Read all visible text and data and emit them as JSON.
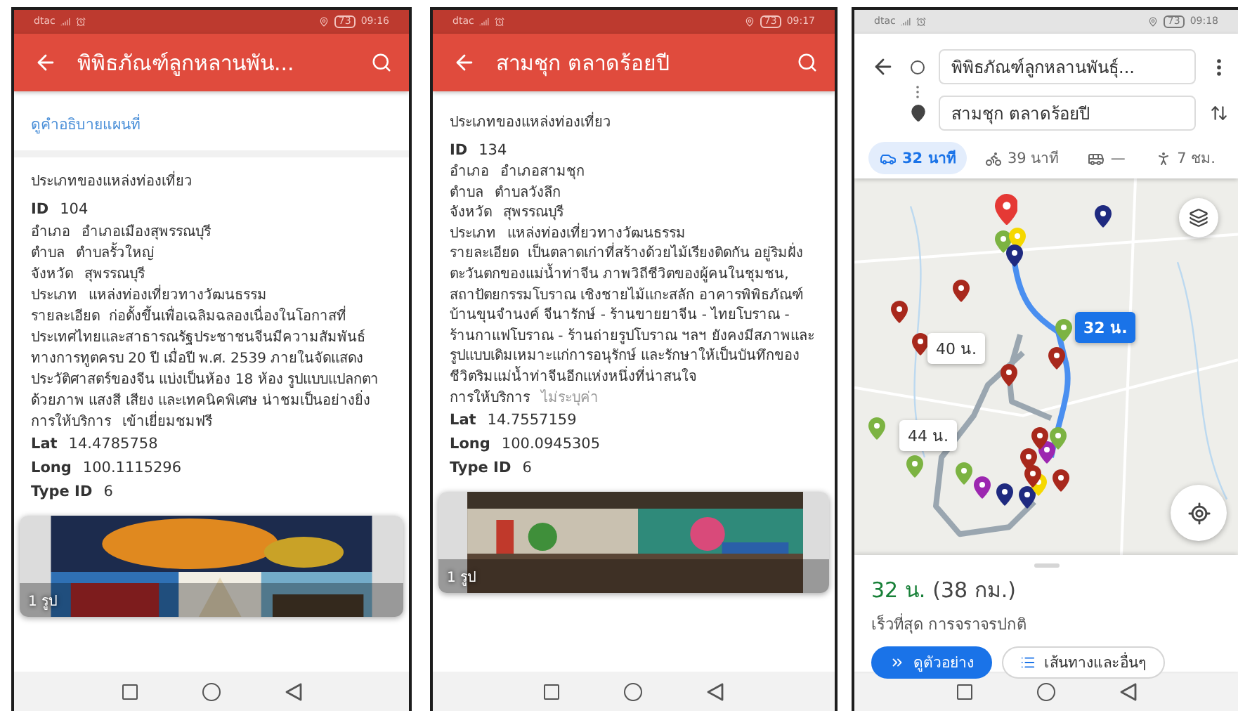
{
  "screens": [
    {
      "kind": "place_detail",
      "status_bar": {
        "carrier": "dtac",
        "battery": "73",
        "time": "09:16"
      },
      "title": "พิพิธภัณฑ์ลูกหลานพัน...",
      "map_link": "ดูคำอธิบายแผนที่",
      "section_title": "ประเภทของแหล่งท่องเที่ยว",
      "fields": [
        {
          "kind": "coded",
          "label": "ID",
          "value": "104"
        },
        {
          "kind": "text",
          "label": "อำเภอ",
          "value": "อำเภอเมืองสุพรรณบุรี"
        },
        {
          "kind": "text",
          "label": "ตำบล",
          "value": "ตำบลรั้วใหญ่"
        },
        {
          "kind": "text",
          "label": "จังหวัด",
          "value": "สุพรรณบุรี"
        },
        {
          "kind": "text",
          "label": "ประเภท",
          "value": "แหล่งท่องเที่ยวทางวัฒนธรรม"
        },
        {
          "kind": "paragraph",
          "text": "รายละเอียด  ก่อตั้งขึ้นเพื่อเฉลิมฉลองเนื่องในโอกาสที่ประเทศไทยและสาธารณรัฐประชาชนจีนมีความสัมพันธ์ทางการทูตครบ 20 ปี เมื่อปี พ.ศ. 2539 ภายในจัดแสดงประวัติศาสตร์ของจีน แบ่งเป็นห้อง 18 ห้อง รูปแบบแปลกตาด้วยภาพ แสงสี เสียง และเทคนิคพิเศษ น่าชมเป็นอย่างยิ่ง"
        },
        {
          "kind": "text",
          "label": "การให้บริการ",
          "value": "เข้าเยี่ยมชมฟรี"
        },
        {
          "kind": "coded",
          "label": "Lat",
          "value": "14.4785758"
        },
        {
          "kind": "coded",
          "label": "Long",
          "value": "100.1115296"
        },
        {
          "kind": "coded",
          "label": "Type ID",
          "value": "6"
        }
      ],
      "photo": {
        "kind": "picture",
        "caption": "1 รูป"
      }
    },
    {
      "kind": "place_detail",
      "status_bar": {
        "carrier": "dtac",
        "battery": "73",
        "time": "09:17"
      },
      "title": "สามชุก ตลาดร้อยปี",
      "section_title": "ประเภทของแหล่งท่องเที่ยว",
      "fields": [
        {
          "kind": "coded",
          "label": "ID",
          "value": "134"
        },
        {
          "kind": "text",
          "label": "อำเภอ",
          "value": "อำเภอสามชุก"
        },
        {
          "kind": "text",
          "label": "ตำบล",
          "value": "ตำบลวังลึก"
        },
        {
          "kind": "text",
          "label": "จังหวัด",
          "value": "สุพรรณบุรี"
        },
        {
          "kind": "text",
          "label": "ประเภท",
          "value": "แหล่งท่องเที่ยวทางวัฒนธรรม"
        },
        {
          "kind": "paragraph",
          "text": "รายละเอียด  เป็นตลาดเก่าที่สร้างด้วยไม้เรียงติดกัน อยู่ริมฝั่งตะวันตกของแม่น้ำท่าจีน ภาพวิถีชีวิตของผู้คนในชุมชน, สถาปัตยกรรมโบราณ เชิงชายไม้แกะสลัก อาคารพิพิธภัณฑ์บ้านขุนจำนงค์ จีนารักษ์ - ร้านขายยาจีน - ไทยโบราณ - ร้านกาแฟโบราณ - ร้านถ่ายรูปโบราณ ฯลฯ ยังคงมีสภาพและรูปแบบเดิมเหมาะแก่การอนุรักษ์ และรักษาให้เป็นบันทึกของชีวิตริมแม่น้ำท่าจีนอีกแห่งหนึ่งที่น่าสนใจ"
        },
        {
          "kind": "empty",
          "label": "การให้บริการ",
          "value": "ไม่ระบุค่า"
        },
        {
          "kind": "coded",
          "label": "Lat",
          "value": "14.7557159"
        },
        {
          "kind": "coded",
          "label": "Long",
          "value": "100.0945305"
        },
        {
          "kind": "coded",
          "label": "Type ID",
          "value": "6"
        }
      ],
      "photo": {
        "kind": "picture",
        "caption": "1 รูป"
      }
    },
    {
      "kind": "directions",
      "status_bar": {
        "carrier": "dtac",
        "battery": "73",
        "time": "09:18"
      },
      "origin": "พิพิธภัณฑ์ลูกหลานพันธุ์...",
      "destination": "สามชุก ตลาดร้อยปี",
      "modes": [
        {
          "kind": "car",
          "label": "32 นาที",
          "selected": true
        },
        {
          "kind": "bike",
          "label": "39 นาที",
          "selected": false
        },
        {
          "kind": "bus",
          "label": "—",
          "selected": false
        },
        {
          "kind": "walk",
          "label": "7 ชม.",
          "selected": false
        }
      ],
      "route_labels": [
        {
          "label": "32 น.",
          "selected": true
        },
        {
          "label": "40 น.",
          "selected": false
        },
        {
          "label": "44 น.",
          "selected": false
        }
      ],
      "summary": {
        "duration": "32 น.",
        "distance": "(38 กม.)",
        "note": "เร็วที่สุด การจราจรปกติ"
      },
      "actions": [
        {
          "kind": "primary",
          "label": "ดูตัวอย่าง"
        },
        {
          "kind": "secondary",
          "label": "เส้นทางและอื่นๆ"
        }
      ]
    }
  ]
}
